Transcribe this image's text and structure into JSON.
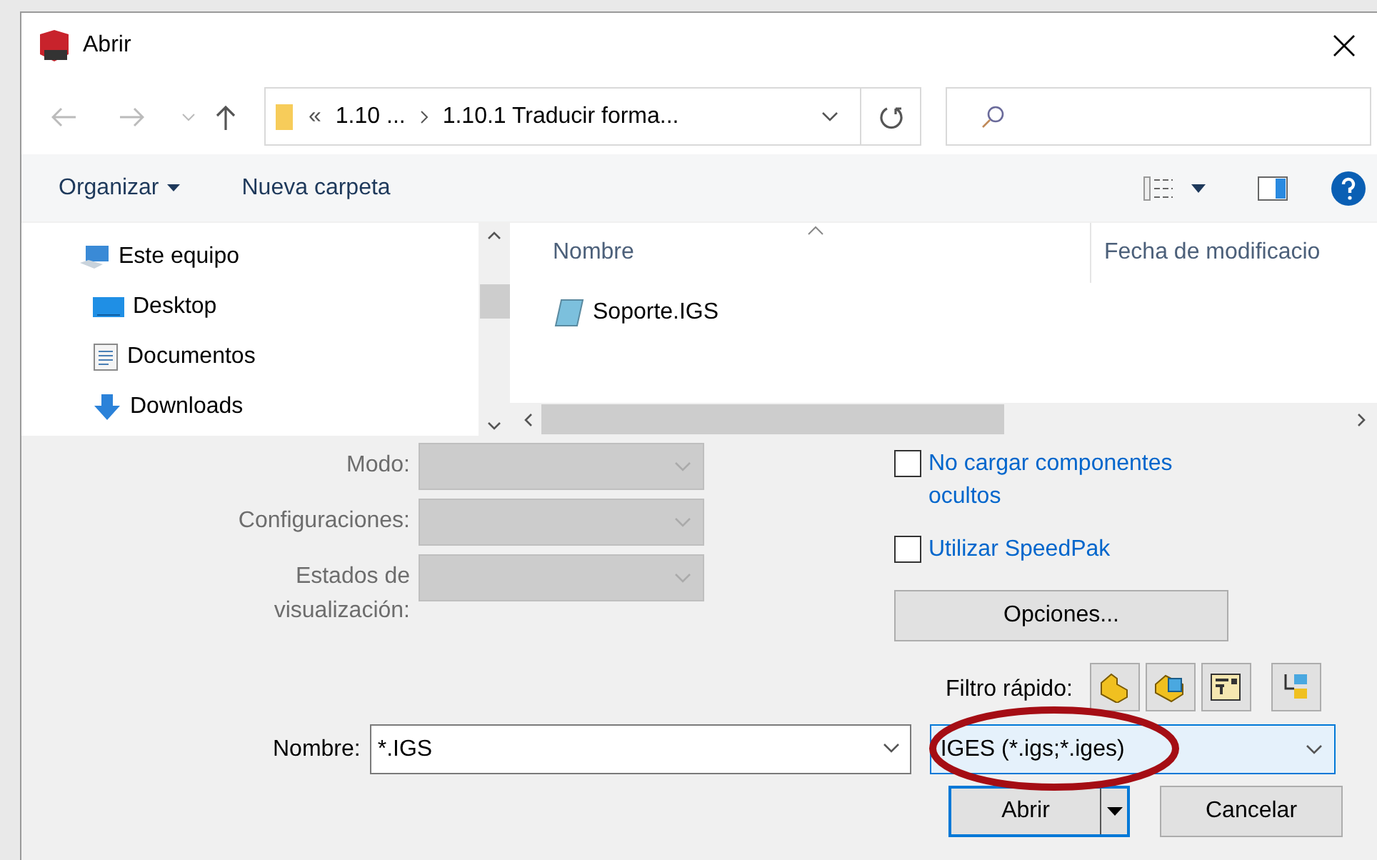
{
  "window": {
    "title": "Abrir"
  },
  "address": {
    "overflow": "«",
    "segments": [
      "1.10 ...",
      "1.10.1 Traducir forma..."
    ]
  },
  "toolbar": {
    "organize": "Organizar",
    "new_folder": "Nueva carpeta"
  },
  "nav_pane": {
    "items": [
      {
        "label": "Este equipo",
        "kind": "computer",
        "children": [
          {
            "label": "Desktop",
            "kind": "desktop"
          },
          {
            "label": "Documentos",
            "kind": "documents"
          },
          {
            "label": "Downloads",
            "kind": "downloads"
          }
        ]
      }
    ]
  },
  "file_list": {
    "columns": [
      "Nombre",
      "Fecha de modificacio"
    ],
    "files": [
      {
        "name": "Soporte.IGS"
      }
    ]
  },
  "fields": [
    {
      "label": "Modo:",
      "disabled": true
    },
    {
      "label": "Configuraciones:",
      "disabled": true
    },
    {
      "label": "Estados de visualización:",
      "disabled": true
    }
  ],
  "checkboxes": [
    {
      "label": "No cargar componentes ocultos",
      "checked": false
    },
    {
      "label": "Utilizar SpeedPak",
      "checked": false
    }
  ],
  "options_button": "Opciones...",
  "quick_filter": {
    "label": "Filtro rápido:"
  },
  "filename": {
    "label": "Nombre:",
    "value": "*.IGS"
  },
  "file_type": {
    "value": "IGES (*.igs;*.iges)"
  },
  "buttons": {
    "open": "Abrir",
    "cancel": "Cancelar"
  }
}
